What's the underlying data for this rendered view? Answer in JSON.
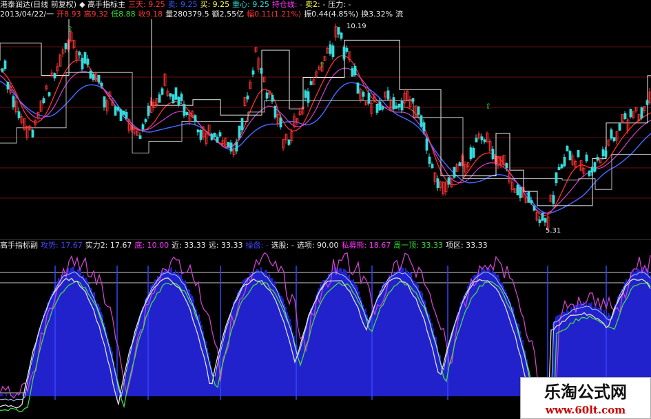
{
  "header": {
    "line1": [
      {
        "text": "港泰润达(日线 前复权)",
        "color": "#e8e8e8"
      },
      {
        "text": "◆ 高手指标主",
        "color": "#e8e8e8"
      },
      {
        "text": "三天: 9.25",
        "color": "#ff3333"
      },
      {
        "text": "卖: 9.25",
        "color": "#3355ff"
      },
      {
        "text": "买: 9.25",
        "color": "#ffff55"
      },
      {
        "text": "重心: 9.25",
        "color": "#33dddd"
      },
      {
        "text": "持仓线: -",
        "color": "#ff33ff"
      },
      {
        "text": "卖2: -",
        "color": "#ffff55"
      },
      {
        "text": "压力: -",
        "color": "#e8e8e8"
      }
    ],
    "line2": [
      {
        "text": "2013/04/22/一",
        "color": "#e8e8e8"
      },
      {
        "text": "开8.93",
        "color": "#ff3333"
      },
      {
        "text": "高9.32",
        "color": "#ff3333"
      },
      {
        "text": "低8.88",
        "color": "#33dd33"
      },
      {
        "text": "收9.18",
        "color": "#ff3333"
      },
      {
        "text": "量280379.5",
        "color": "#e8e8e8"
      },
      {
        "text": "额2.55亿",
        "color": "#e8e8e8"
      },
      {
        "text": "幅0.11(1.21%)",
        "color": "#ff3333"
      },
      {
        "text": "振0.44(4.85%)",
        "color": "#e8e8e8"
      },
      {
        "text": "换3.32%",
        "color": "#e8e8e8"
      },
      {
        "text": "流",
        "color": "#e8e8e8"
      }
    ]
  },
  "sub_header": [
    {
      "text": "高手指标副",
      "color": "#e8e8e8"
    },
    {
      "text": "攻势: 17.67",
      "color": "#4444ff"
    },
    {
      "text": "实力2: 17.67",
      "color": "#e8e8e8"
    },
    {
      "text": "底: 10.00",
      "color": "#ff33ff"
    },
    {
      "text": "近: 33.33",
      "color": "#e8e8e8"
    },
    {
      "text": "远: 33.33",
      "color": "#e8e8e8"
    },
    {
      "text": "操盘: -",
      "color": "#4444ff"
    },
    {
      "text": "选股: -",
      "color": "#e8e8e8"
    },
    {
      "text": "选项: 90.00",
      "color": "#e8e8e8"
    },
    {
      "text": "私募熊: 18.67",
      "color": "#ff33ff"
    },
    {
      "text": "周一顶: 33.33",
      "color": "#33dd33"
    },
    {
      "text": "项区: 33.33",
      "color": "#e8e8e8"
    }
  ],
  "price_labels": {
    "high": "10.19",
    "low": "5.31"
  },
  "colors": {
    "up_candle": "#ff3333",
    "down_candle": "#33dddd",
    "ma_white": "#f0f0f0",
    "ma_red": "#ff3030",
    "ma_blue": "#4466ff",
    "ma_magenta": "#cc44cc",
    "ma_green": "#44dd44",
    "hist_blue": "#2222cc",
    "grid_red": "#661111"
  },
  "watermark": {
    "title": "乐淘公式网",
    "url": "www.60lt.com"
  }
}
